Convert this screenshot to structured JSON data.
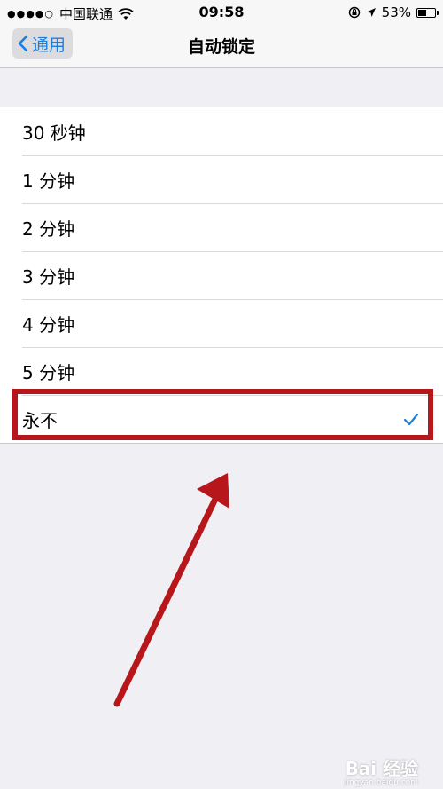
{
  "status_bar": {
    "signal": "●●●●○",
    "carrier": "中国联通",
    "time": "09:58",
    "battery_text": "53%",
    "battery_level": 0.53
  },
  "nav": {
    "back_label": "通用",
    "title": "自动锁定"
  },
  "options": [
    {
      "label": "30 秒钟",
      "selected": false
    },
    {
      "label": "1 分钟",
      "selected": false
    },
    {
      "label": "2 分钟",
      "selected": false
    },
    {
      "label": "3 分钟",
      "selected": false
    },
    {
      "label": "4 分钟",
      "selected": false
    },
    {
      "label": "5 分钟",
      "selected": false
    },
    {
      "label": "永不",
      "selected": true
    }
  ],
  "icons": {
    "wifi": "wifi-icon",
    "lock_rotation": "rotation-lock-icon",
    "location": "location-arrow-icon",
    "battery": "battery-icon",
    "back": "chevron-left-icon",
    "check": "checkmark-icon"
  },
  "colors": {
    "accent": "#1b7fe0",
    "annotation": "#b7161a"
  },
  "watermark": {
    "brand": "Bai 经验",
    "url": "jingyan.baidu.com"
  }
}
